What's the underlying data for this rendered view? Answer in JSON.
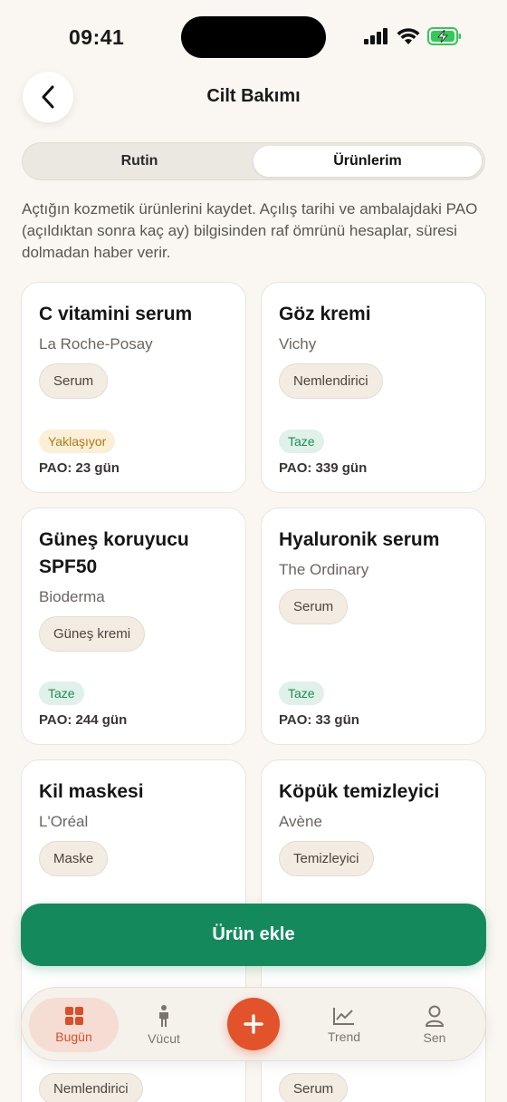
{
  "status_bar": {
    "time": "09:41"
  },
  "header": {
    "title": "Cilt Bakımı"
  },
  "segments": [
    {
      "label": "Rutin",
      "active": false
    },
    {
      "label": "Ürünlerim",
      "active": true
    }
  ],
  "description": "Açtığın kozmetik ürünlerini kaydet. Açılış tarihi ve ambalajdaki PAO (açıldıktan sonra kaç ay) bilgisinden raf ömrünü hesaplar, süresi dolmadan haber verir.",
  "products": [
    {
      "name": "C vitamini serum",
      "brand": "La Roche-Posay",
      "category": "Serum",
      "status": "Yaklaşıyor",
      "status_type": "warn",
      "pao": "PAO: 23 gün"
    },
    {
      "name": "Göz kremi",
      "brand": "Vichy",
      "category": "Nemlendirici",
      "status": "Taze",
      "status_type": "fresh",
      "pao": "PAO: 339 gün"
    },
    {
      "name": "Güneş koruyucu SPF50",
      "brand": "Bioderma",
      "category": "Güneş kremi",
      "status": "Taze",
      "status_type": "fresh",
      "pao": "PAO: 244 gün"
    },
    {
      "name": "Hyaluronik serum",
      "brand": "The Ordinary",
      "category": "Serum",
      "status": "Taze",
      "status_type": "fresh",
      "pao": "PAO: 33 gün"
    },
    {
      "name": "Kil maskesi",
      "brand": "L'Oréal",
      "category": "Maske"
    },
    {
      "name": "Köpük temizleyici",
      "brand": "Avène",
      "category": "Temizleyici"
    }
  ],
  "peek_chips": [
    "Nemlendirici",
    "Serum"
  ],
  "add_button": {
    "label": "Ürün ekle"
  },
  "tabbar": {
    "items": [
      {
        "label": "Bugün",
        "icon": "grid-icon",
        "active": true
      },
      {
        "label": "Vücut",
        "icon": "person-icon",
        "active": false
      },
      {
        "label": "Trend",
        "icon": "trend-chart-icon",
        "active": false
      },
      {
        "label": "Sen",
        "icon": "user-icon",
        "active": false
      }
    ],
    "fab_icon": "plus-icon"
  },
  "colors": {
    "accent_green": "#148a5c",
    "accent_orange": "#e2522b",
    "warn": "#b07a16",
    "fresh": "#1f8a5a"
  }
}
